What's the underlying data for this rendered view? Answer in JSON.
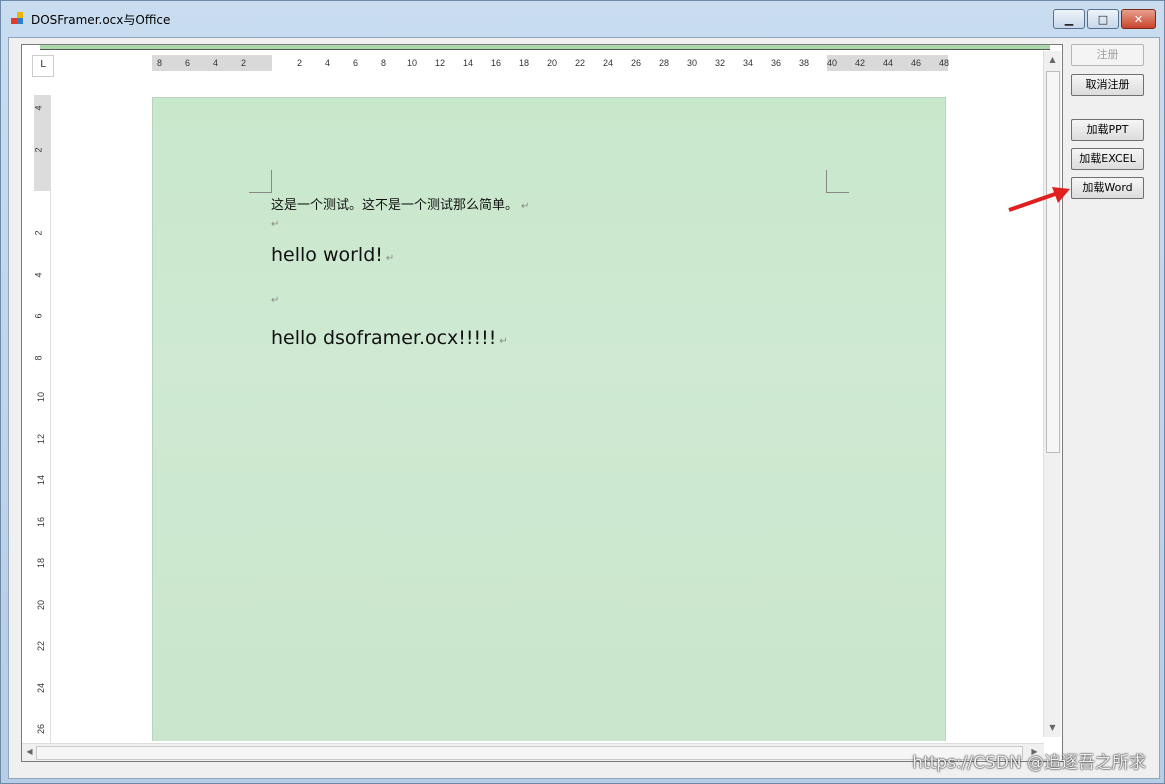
{
  "window": {
    "title": "DOSFramer.ocx与Office",
    "buttons": {
      "minimize": "▁",
      "maximize": "□",
      "close": "✕"
    }
  },
  "ruler": {
    "corner": "L",
    "h_ticks": [
      "8",
      "6",
      "4",
      "2",
      "2",
      "4",
      "6",
      "8",
      "10",
      "12",
      "14",
      "16",
      "18",
      "20",
      "22",
      "24",
      "26",
      "28",
      "30",
      "32",
      "34",
      "36",
      "38",
      "40",
      "42",
      "44",
      "46",
      "48"
    ],
    "v_ticks": [
      "4",
      "2",
      "2",
      "4",
      "6",
      "8",
      "10",
      "12",
      "14",
      "16",
      "18",
      "20",
      "22",
      "24",
      "26"
    ]
  },
  "document": {
    "line1": "这是一个测试。这不是一个测试那么简单。",
    "line3": "hello world!",
    "line5": "hello dsoframer.ocx!!!!!",
    "para_mark": "↵"
  },
  "side_buttons": {
    "register": "注册",
    "unregister": "取消注册",
    "load_ppt": "加载PPT",
    "load_excel": "加载EXCEL",
    "load_word": "加载Word"
  },
  "scroll": {
    "up": "▲",
    "down": "▼",
    "left": "◀",
    "right": "▶"
  },
  "watermark": "https://CSDN @追逐吾之所求",
  "colors": {
    "page_fill": "#cbe8cf",
    "arrow": "#e0201e"
  }
}
